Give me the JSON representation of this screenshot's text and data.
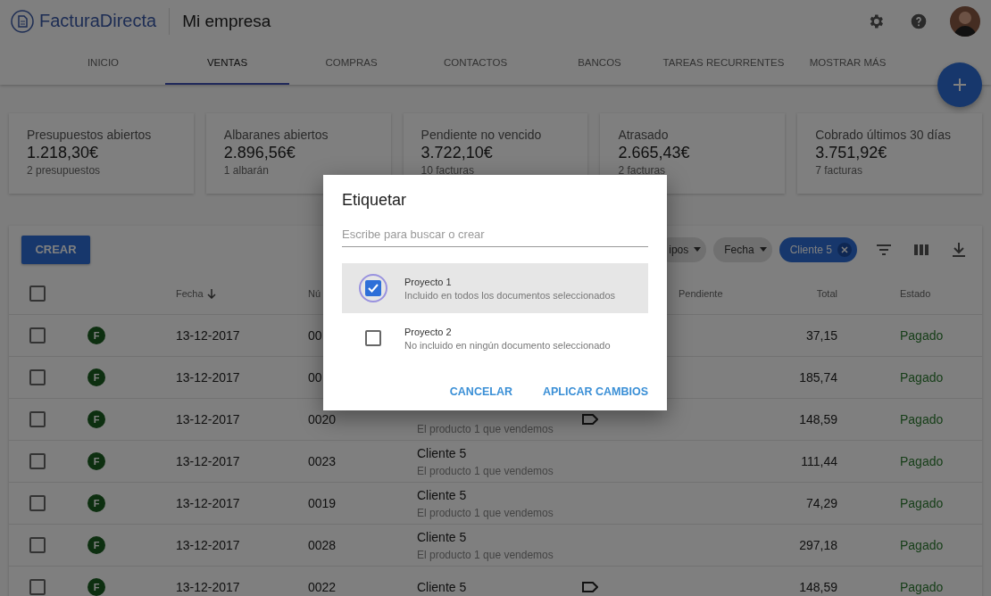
{
  "header": {
    "logo_text": "FacturaDirecta",
    "company": "Mi empresa"
  },
  "tabs": [
    {
      "label": "INICIO",
      "selected": false
    },
    {
      "label": "VENTAS",
      "selected": true
    },
    {
      "label": "COMPRAS",
      "selected": false
    },
    {
      "label": "CONTACTOS",
      "selected": false
    },
    {
      "label": "BANCOS",
      "selected": false
    },
    {
      "label": "TAREAS RECURRENTES",
      "selected": false
    },
    {
      "label": "MOSTRAR MÁS",
      "selected": false
    }
  ],
  "summary_cards": [
    {
      "title": "Presupuestos abiertos",
      "amount": "1.218,30€",
      "subtitle": "2 presupuestos"
    },
    {
      "title": "Albaranes abiertos",
      "amount": "2.896,56€",
      "subtitle": "1 albarán"
    },
    {
      "title": "Pendiente no vencido",
      "amount": "3.722,10€",
      "subtitle": "10 facturas"
    },
    {
      "title": "Atrasado",
      "amount": "2.665,43€",
      "subtitle": "2 facturas"
    },
    {
      "title": "Cobrado últimos 30 días",
      "amount": "3.751,92€",
      "subtitle": "7 facturas"
    }
  ],
  "toolbar": {
    "create_button": "CREAR",
    "filters": [
      {
        "label": "ipos",
        "kind": "dropdown"
      },
      {
        "label": "Fecha",
        "kind": "dropdown"
      },
      {
        "label": "Cliente 5",
        "kind": "removable"
      }
    ]
  },
  "table": {
    "select_all_checked": false,
    "columns": [
      {
        "label": "Fecha",
        "sorted": true
      },
      {
        "label": "Nú"
      },
      {
        "label": "Pendiente",
        "sorted": false
      },
      {
        "label": "Total",
        "sorted": false
      },
      {
        "label": "Estado",
        "sorted": false
      }
    ],
    "rows": [
      {
        "badge": "F",
        "date": "13-12-2017",
        "number": "00",
        "total": "37,15",
        "status": "Pagado",
        "selected": false
      },
      {
        "badge": "F",
        "date": "13-12-2017",
        "number": "00",
        "total": "185,74",
        "status": "Pagado",
        "selected": false
      },
      {
        "badge": "F",
        "date": "13-12-2017",
        "number": "0020",
        "description": "El producto 1 que vendemos",
        "tagged": true,
        "total": "148,59",
        "status": "Pagado",
        "selected": false
      },
      {
        "badge": "F",
        "date": "13-12-2017",
        "number": "0023",
        "client": "Cliente 5",
        "description": "El producto 1 que vendemos",
        "tagged": false,
        "total": "111,44",
        "status": "Pagado",
        "selected": false
      },
      {
        "badge": "F",
        "date": "13-12-2017",
        "number": "0019",
        "client": "Cliente 5",
        "description": "El producto 1 que vendemos",
        "tagged": false,
        "total": "74,29",
        "status": "Pagado",
        "selected": false
      },
      {
        "badge": "F",
        "date": "13-12-2017",
        "number": "0028",
        "client": "Cliente 5",
        "description": "El producto 1 que vendemos",
        "tagged": false,
        "total": "297,18",
        "status": "Pagado",
        "selected": false
      },
      {
        "badge": "F",
        "date": "13-12-2017",
        "number": "0022",
        "client": "Cliente 5",
        "tagged": true,
        "total": "148,59",
        "status": "Pagado",
        "selected": false
      }
    ]
  },
  "dialog": {
    "title": "Etiquetar",
    "search": {
      "placeholder": "Escribe para buscar o crear"
    },
    "options": [
      {
        "name": "Proyecto 1",
        "description": "Incluido en todos los documentos seleccionados",
        "checked": true,
        "highlighted": true
      },
      {
        "name": "Proyecto 2",
        "description": "No incluido en ningún documento seleccionado",
        "checked": false,
        "highlighted": false
      }
    ],
    "buttons": [
      "CANCELAR",
      "APLICAR CAMBIOS"
    ]
  }
}
